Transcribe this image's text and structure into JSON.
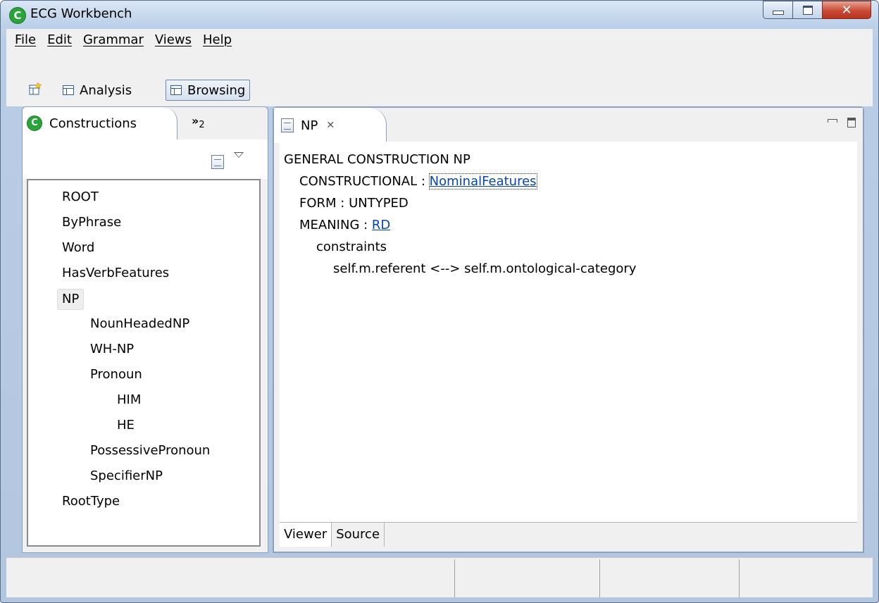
{
  "window": {
    "title": "ECG Workbench",
    "app_icon_letter": "C"
  },
  "menu": [
    "File",
    "Edit",
    "Grammar",
    "Views",
    "Help"
  ],
  "toolbar": {
    "analysis_label": "Analysis",
    "browsing_label": "Browsing"
  },
  "left_panel": {
    "tab_label": "Constructions",
    "overflow_label": "»",
    "overflow_count": "2",
    "tree": [
      {
        "label": "ROOT",
        "depth": 0
      },
      {
        "label": "ByPhrase",
        "depth": 0
      },
      {
        "label": "Word",
        "depth": 0
      },
      {
        "label": "HasVerbFeatures",
        "depth": 0
      },
      {
        "label": "NP",
        "depth": 0,
        "selected": true
      },
      {
        "label": "NounHeadedNP",
        "depth": 1
      },
      {
        "label": "WH-NP",
        "depth": 1
      },
      {
        "label": "Pronoun",
        "depth": 1
      },
      {
        "label": "HIM",
        "depth": 2
      },
      {
        "label": "HE",
        "depth": 2
      },
      {
        "label": "PossessivePronoun",
        "depth": 1
      },
      {
        "label": "SpecifierNP",
        "depth": 1
      },
      {
        "label": "RootType",
        "depth": 0
      }
    ]
  },
  "editor": {
    "tab_label": "NP",
    "header_line": "GENERAL CONSTRUCTION NP",
    "constructional_label": "CONSTRUCTIONAL : ",
    "constructional_link": "NominalFeatures",
    "form_line": "FORM : UNTYPED",
    "meaning_label": "MEANING : ",
    "meaning_link": "RD",
    "constraints_label": "constraints",
    "constraint_line": "self.m.referent <--> self.m.ontological-category",
    "bottom_tabs": [
      "Viewer",
      "Source"
    ]
  },
  "colors": {
    "link": "#0645ad",
    "app_icon": "#2aa33a"
  }
}
